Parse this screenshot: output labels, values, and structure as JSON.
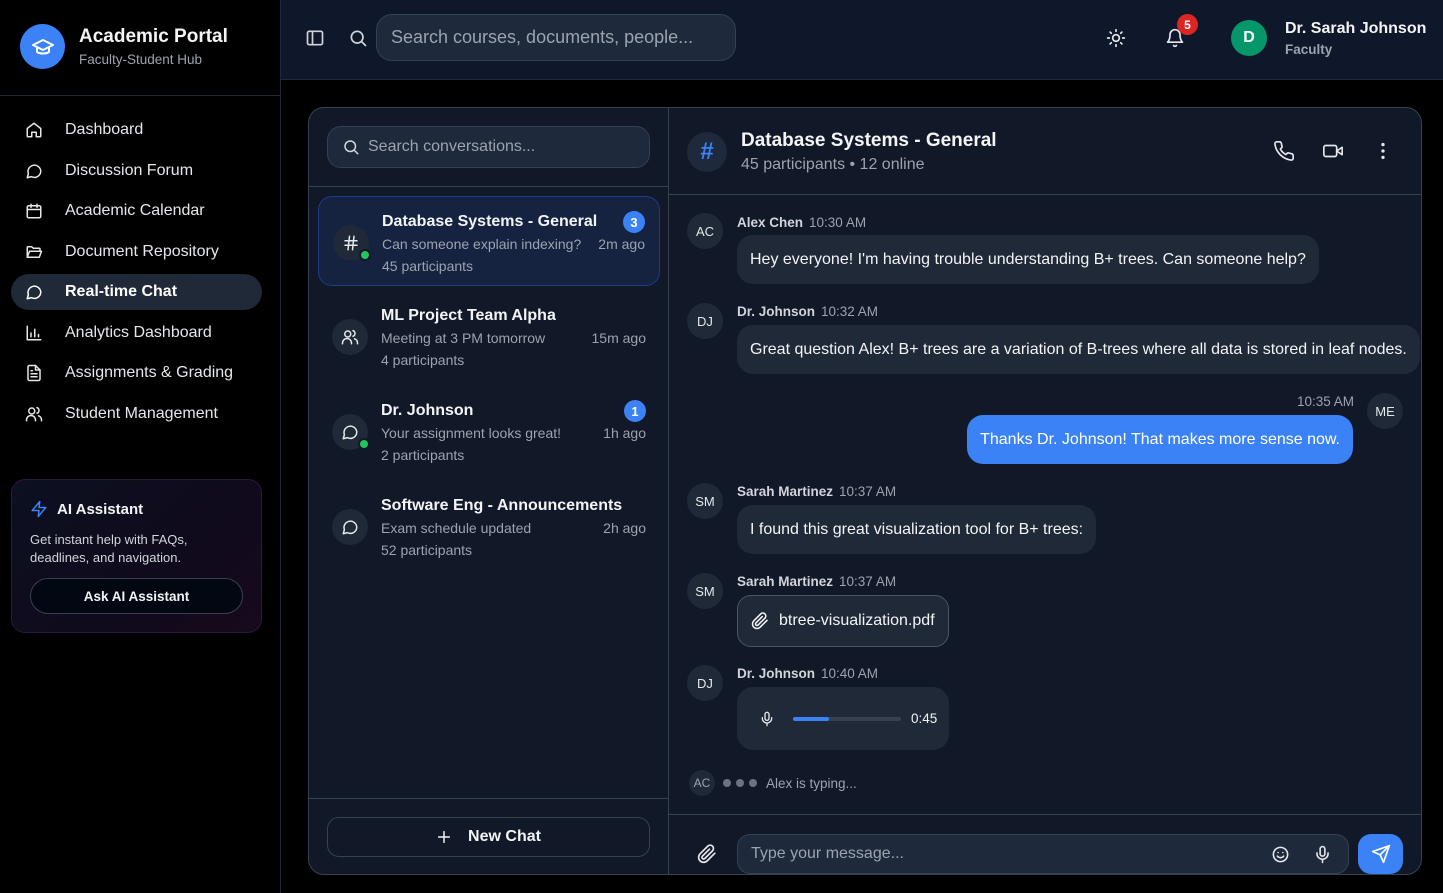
{
  "brand": {
    "title": "Academic Portal",
    "subtitle": "Faculty-Student Hub"
  },
  "sidebar": {
    "items": [
      {
        "label": "Dashboard",
        "icon": "home-icon"
      },
      {
        "label": "Discussion Forum",
        "icon": "message-circle-icon"
      },
      {
        "label": "Academic Calendar",
        "icon": "calendar-icon"
      },
      {
        "label": "Document Repository",
        "icon": "folder-open-icon"
      },
      {
        "label": "Real-time Chat",
        "icon": "message-circle-icon",
        "active": true
      },
      {
        "label": "Analytics Dashboard",
        "icon": "bar-chart-icon"
      },
      {
        "label": "Assignments & Grading",
        "icon": "file-text-icon"
      },
      {
        "label": "Student Management",
        "icon": "users-icon"
      }
    ]
  },
  "ai_assistant": {
    "title": "AI Assistant",
    "description": "Get instant help with FAQs, deadlines, and navigation.",
    "button": "Ask AI Assistant"
  },
  "topbar": {
    "search_placeholder": "Search courses, documents, people...",
    "notification_count": "5",
    "user": {
      "initial": "D",
      "name": "Dr. Sarah Johnson",
      "role": "Faculty"
    }
  },
  "conversations": {
    "search_placeholder": "Search conversations...",
    "items": [
      {
        "name": "Database Systems - General",
        "last": "Can someone explain indexing?",
        "participants": "45 participants",
        "time": "2m ago",
        "unread": "3",
        "icon": "hash-icon",
        "online": true,
        "active": true
      },
      {
        "name": "ML Project Team Alpha",
        "last": "Meeting at 3 PM tomorrow",
        "participants": "4 participants",
        "time": "15m ago",
        "unread": "",
        "icon": "users-icon",
        "online": false,
        "active": false
      },
      {
        "name": "Dr. Johnson",
        "last": "Your assignment looks great!",
        "participants": "2 participants",
        "time": "1h ago",
        "unread": "1",
        "icon": "message-circle-icon",
        "online": true,
        "active": false
      },
      {
        "name": "Software Eng - Announcements",
        "last": "Exam schedule updated",
        "participants": "52 participants",
        "time": "2h ago",
        "unread": "",
        "icon": "message-circle-icon",
        "online": false,
        "active": false
      }
    ],
    "new_chat": "New Chat"
  },
  "chat": {
    "channel_symbol": "#",
    "channel_name": "Database Systems - General",
    "channel_meta": "45 participants • 12 online",
    "messages": [
      {
        "initials": "AC",
        "sender": "Alex Chen",
        "time": "10:30 AM",
        "text": "Hey everyone! I'm having trouble understanding B+ trees. Can someone help?"
      },
      {
        "initials": "DJ",
        "sender": "Dr. Johnson",
        "time": "10:32 AM",
        "text": "Great question Alex! B+ trees are a variation of B-trees where all data is stored in leaf nodes."
      },
      {
        "initials": "ME",
        "sender": "",
        "time": "10:35 AM",
        "text": "Thanks Dr. Johnson! That makes more sense now."
      },
      {
        "initials": "SM",
        "sender": "Sarah Martinez",
        "time": "10:37 AM",
        "text": "I found this great visualization tool for B+ trees:"
      },
      {
        "initials": "SM",
        "sender": "Sarah Martinez",
        "time": "10:37 AM",
        "file": "btree-visualization.pdf"
      },
      {
        "initials": "DJ",
        "sender": "Dr. Johnson",
        "time": "10:40 AM",
        "audio_duration": "0:45",
        "audio_progress": 0.33
      }
    ],
    "typing": {
      "initials": "AC",
      "text": "Alex is typing..."
    },
    "input_placeholder": "Type your message..."
  },
  "colors": {
    "accent": "#3b82f6",
    "online": "#22c55e",
    "badge": "#dc2626",
    "avatar_user": "#059669"
  }
}
